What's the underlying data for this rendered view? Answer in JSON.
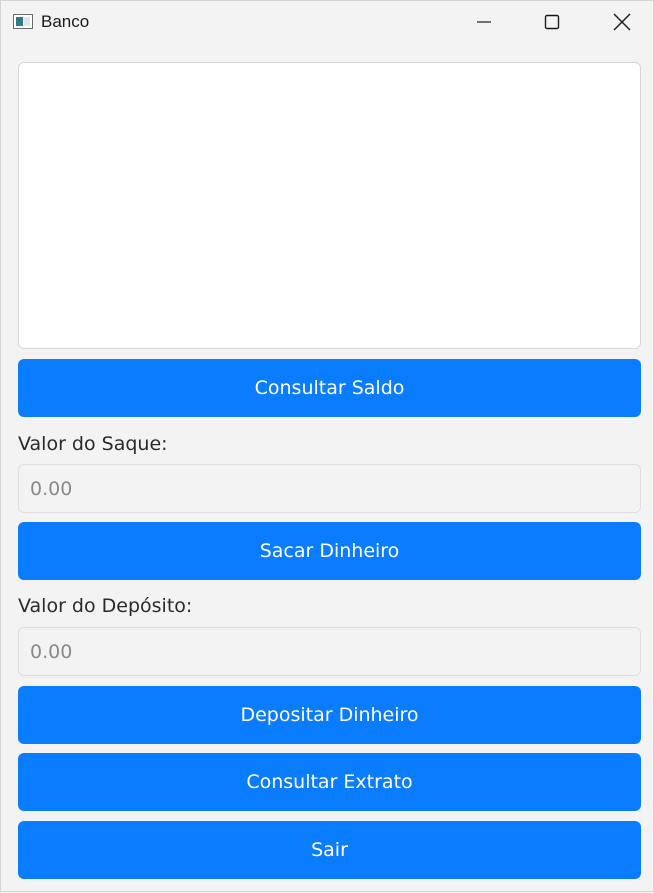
{
  "window": {
    "title": "Banco",
    "controls": {
      "minimize_icon": "minimize-icon",
      "maximize_icon": "maximize-icon",
      "close_icon": "close-icon"
    }
  },
  "output_area": {
    "value": ""
  },
  "buttons": {
    "consultar_saldo": "Consultar Saldo",
    "sacar": "Sacar Dinheiro",
    "depositar": "Depositar Dinheiro",
    "extrato": "Consultar Extrato",
    "sair": "Sair"
  },
  "saque": {
    "label": "Valor do Saque:",
    "placeholder": "0.00"
  },
  "deposito": {
    "label": "Valor do Depósito:",
    "placeholder": "0.00"
  },
  "colors": {
    "accent": "#0a7cff",
    "background": "#f3f3f3"
  }
}
